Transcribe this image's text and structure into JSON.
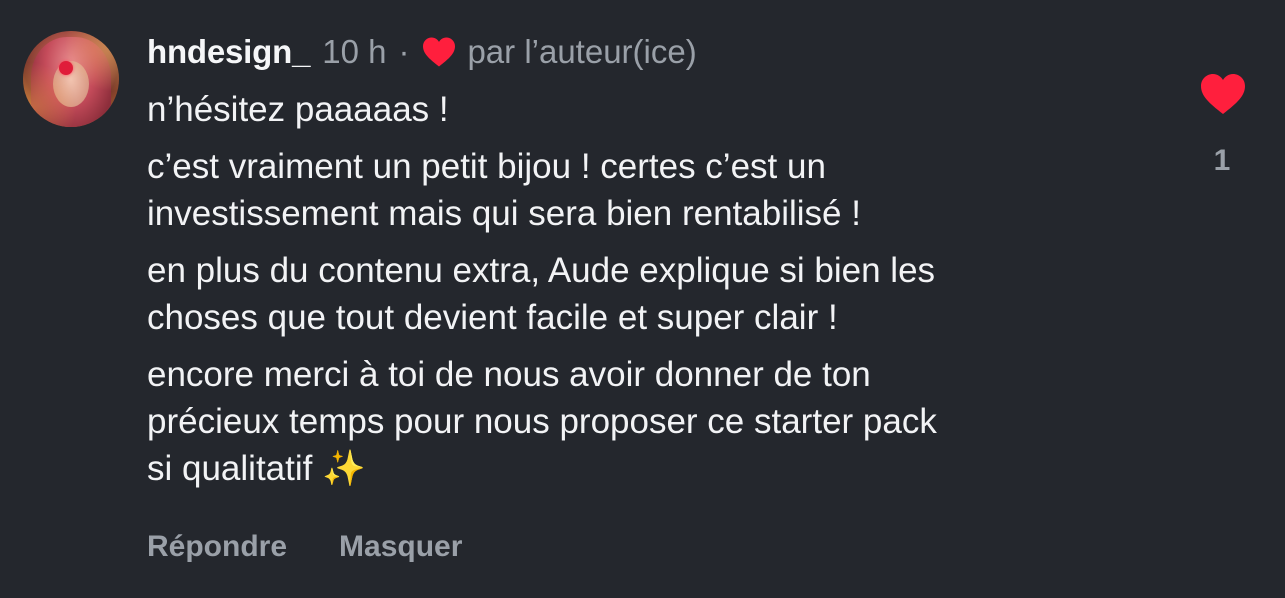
{
  "comment": {
    "username": "hndesign_",
    "time": "10 h",
    "separator": "·",
    "author_like_label": "par l’auteur(ice)",
    "paragraphs": [
      "n’hésitez paaaaas !",
      "c’est vraiment un petit bijou ! certes c’est un\ninvestissement mais qui sera bien rentabilisé !",
      "en plus du contenu extra, Aude explique si bien les\nchoses que tout devient facile et super clair !",
      "encore merci à toi de nous avoir donner de ton\nprécieux temps pour nous proposer ce starter pack\nsi qualitatif ✨"
    ],
    "like_count": "1",
    "actions": {
      "reply": "Répondre",
      "hide": "Masquer"
    }
  },
  "colors": {
    "background": "#24272d",
    "heart": "#ff1f3d",
    "muted_text": "#9aa0a8"
  },
  "icons": {
    "author_heart": "heart-icon",
    "like": "heart-icon",
    "avatar": "user-avatar"
  }
}
